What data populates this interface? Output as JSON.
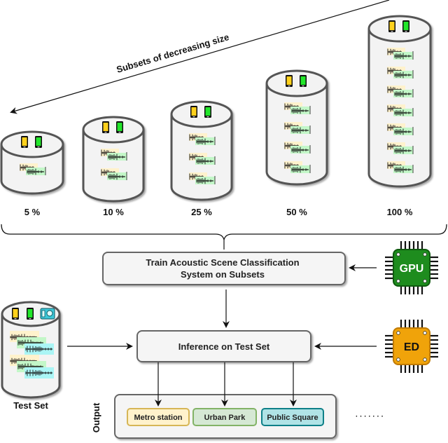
{
  "title_arrow": {
    "label": "Subsets of decreasing size"
  },
  "subsets": [
    {
      "label": "5 %",
      "clips": 1
    },
    {
      "label": "10 %",
      "clips": 2
    },
    {
      "label": "25 %",
      "clips": 3
    },
    {
      "label": "50 %",
      "clips": 4
    },
    {
      "label": "100 %",
      "clips": 7
    }
  ],
  "train_box": {
    "line1": "Train Acoustic Scene Classification",
    "line2": "System on Subsets"
  },
  "inference_box": {
    "label": "Inference on Test Set"
  },
  "test_set": {
    "label": "Test Set",
    "devices": [
      "phone-yellow-icon",
      "phone-green-icon",
      "action-camera-icon"
    ]
  },
  "devices_icons": [
    "phone-yellow-icon",
    "phone-green-icon"
  ],
  "chips": [
    {
      "label": "GPU",
      "fill": "#1e8c1e",
      "stroke": "#0f5a0f"
    },
    {
      "label": "ED",
      "fill": "#f0a30a",
      "stroke": "#c07a00"
    }
  ],
  "output": {
    "axis_label": "Output",
    "classes": [
      {
        "label": "Metro station",
        "fill": "#fff2cc",
        "stroke": "#d6b656"
      },
      {
        "label": "Urban Park",
        "fill": "#d5e8d4",
        "stroke": "#82b366"
      },
      {
        "label": "Public Square",
        "fill": "#b0e3e6",
        "stroke": "#0e8088"
      }
    ],
    "ellipsis": "· · · · · · ·"
  },
  "colors": {
    "cylinder_fill": "#f3f3f3",
    "cylinder_stroke": "#555555",
    "phone_yellow": "#ffd11a",
    "phone_green": "#22e62b",
    "clip_yellow": "#fff2cc",
    "clip_green": "#c3f7c8",
    "clip_cyan": "#aaf5f5",
    "box_fill": "#f5f5f5",
    "box_stroke": "#666666"
  }
}
